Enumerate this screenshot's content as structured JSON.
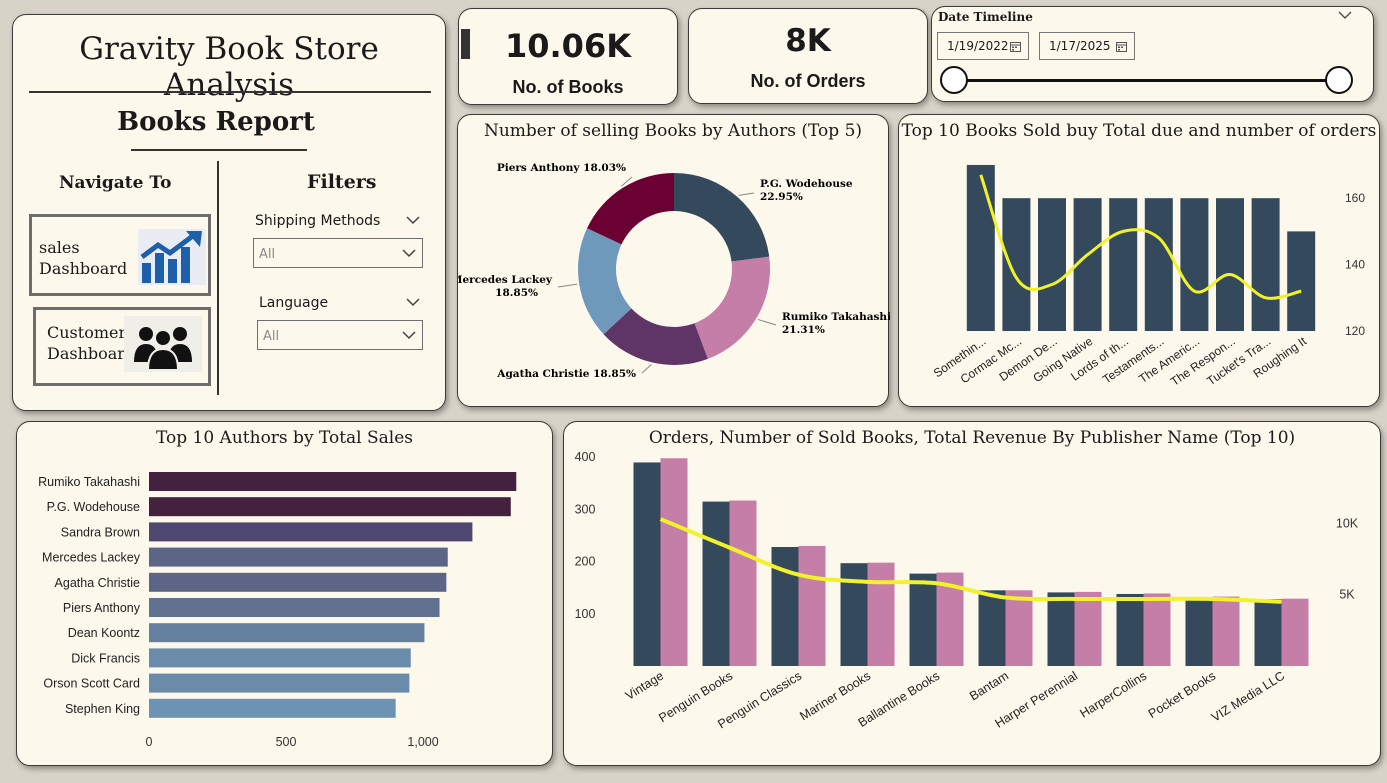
{
  "nav": {
    "app_title": "Gravity Book Store Analysis",
    "report_title": "Books Report",
    "navigate_label": "Navigate To",
    "filters_label": "Filters",
    "sales_button": "sales\nDashboard",
    "customer_button": "Customer\nDashboard",
    "filters": {
      "shipping": {
        "title": "Shipping Methods",
        "value": "All"
      },
      "language": {
        "title": "Language",
        "value": "All"
      }
    }
  },
  "kpis": {
    "books": {
      "value": "10.06K",
      "label": "No. of Books"
    },
    "orders": {
      "value": "8K",
      "label": "No. of Orders"
    }
  },
  "date_slicer": {
    "title": "Date Timeline",
    "start": "1/19/2022",
    "end": "1/17/2025"
  },
  "colors": {
    "dark_slate": "#344a5c",
    "mauve": "#c57ea8",
    "trend_yellow": "#f2f22a",
    "panel_bg": "#fdf8ec"
  },
  "chart_data": [
    {
      "id": "donut",
      "type": "pie",
      "title": "Number of selling Books by Authors (Top 5)",
      "slices": [
        {
          "label": "P.G. Wodehouse",
          "value": 22.95,
          "pct": "22.95%",
          "color": "#344a5c"
        },
        {
          "label": "Rumiko Takahashi",
          "value": 21.31,
          "pct": "21.31%",
          "color": "#c57ea8"
        },
        {
          "label": "Agatha Christie",
          "value": 18.85,
          "pct": "18.85%",
          "color": "#5f3466"
        },
        {
          "label": "Mercedes Lackey",
          "value": 18.85,
          "pct": "18.85%",
          "color": "#6f99bb"
        },
        {
          "label": "Piers Anthony",
          "value": 18.03,
          "pct": "18.03%",
          "color": "#6b0033"
        }
      ]
    },
    {
      "id": "top10books",
      "type": "bar",
      "title": "Top 10 Books Sold buy Total due and number of orders",
      "categories": [
        "Somethin...",
        "Cormac Mc...",
        "Demon De...",
        "Going Native",
        "Lords of th...",
        "Testaments...",
        "The Americ...",
        "The Respon...",
        "Tucket's Tra...",
        "Roughing It"
      ],
      "series": [
        {
          "type": "bar",
          "axis": "right",
          "values": [
            170,
            160,
            160,
            160,
            160,
            160,
            160,
            160,
            160,
            150
          ]
        },
        {
          "type": "line",
          "axis": "hidden",
          "values": [
            167,
            136,
            134,
            143,
            150,
            148,
            132,
            137,
            130,
            132
          ]
        }
      ],
      "y_right_ticks": [
        120,
        140,
        160
      ],
      "ylim": [
        120,
        173
      ]
    },
    {
      "id": "authors",
      "type": "bar",
      "orientation": "horizontal",
      "title": "Top 10 Authors by Total Sales",
      "categories": [
        "Rumiko Takahashi",
        "P.G. Wodehouse",
        "Sandra Brown",
        "Mercedes Lackey",
        "Agatha Christie",
        "Piers Anthony",
        "Dean Koontz",
        "Dick Francis",
        "Orson Scott Card",
        "Stephen King"
      ],
      "values": [
        1340,
        1320,
        1180,
        1090,
        1085,
        1060,
        1005,
        955,
        950,
        900
      ],
      "colors": [
        "#43213f",
        "#43213f",
        "#4e4870",
        "#5d6586",
        "#5d6586",
        "#617190",
        "#66809f",
        "#6b8bab",
        "#6b8bab",
        "#6d93b4"
      ],
      "x_ticks": [
        0,
        500,
        1000
      ],
      "x_tick_labels": [
        "0",
        "500",
        "1,000"
      ],
      "xlim": [
        0,
        1350
      ]
    },
    {
      "id": "publishers",
      "type": "bar",
      "title": "Orders, Number of Sold Books, Total Revenue By Publisher Name (Top 10)",
      "categories": [
        "Vintage",
        "Penguin Books",
        "Penguin Classics",
        "Mariner Books",
        "Ballantine Books",
        "Bantam",
        "Harper Perennial",
        "HarperCollins",
        "Pocket Books",
        "VIZ Media LLC"
      ],
      "series": [
        {
          "type": "bar",
          "color": "#344a5c",
          "values": [
            390,
            315,
            228,
            197,
            177,
            145,
            141,
            138,
            131,
            128
          ]
        },
        {
          "type": "bar",
          "color": "#c57ea8",
          "values": [
            398,
            317,
            230,
            198,
            179,
            145,
            142,
            139,
            133,
            129
          ]
        },
        {
          "type": "line",
          "color": "#f2f22a",
          "values": [
            10300,
            8300,
            6400,
            5900,
            5800,
            4800,
            4700,
            4700,
            4700,
            4500
          ]
        }
      ],
      "y_left_ticks": [
        100,
        200,
        300,
        400
      ],
      "ylim_left": [
        0,
        410
      ],
      "y_right_ticks": [
        5000,
        10000
      ],
      "y_right_tick_labels": [
        "5K",
        "10K"
      ],
      "ylim_right": [
        0,
        15000
      ]
    }
  ]
}
